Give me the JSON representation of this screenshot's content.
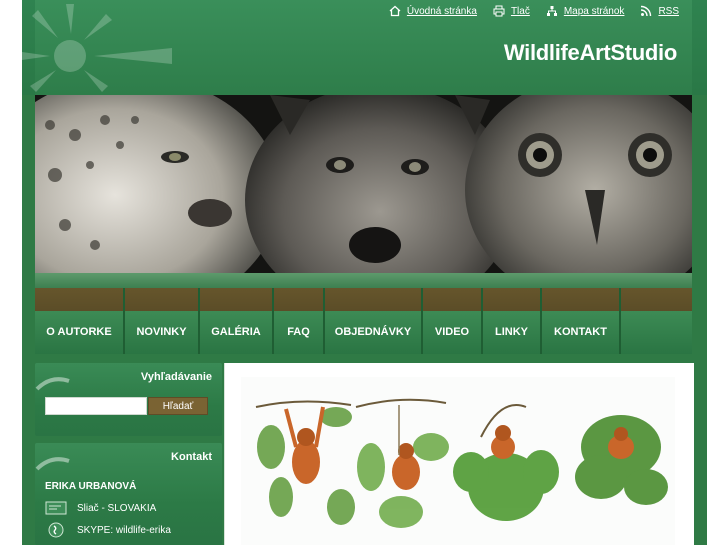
{
  "toplinks": [
    {
      "label": "Úvodná stránka",
      "icon": "home-icon"
    },
    {
      "label": "Tlač",
      "icon": "print-icon"
    },
    {
      "label": "Mapa stránok",
      "icon": "sitemap-icon"
    },
    {
      "label": "RSS",
      "icon": "rss-icon"
    }
  ],
  "site_title": "WildlifeArtStudio",
  "nav": [
    {
      "label": "O AUTORKE"
    },
    {
      "label": "NOVINKY"
    },
    {
      "label": "GALÉRIA"
    },
    {
      "label": "FAQ"
    },
    {
      "label": "OBJEDNÁVKY"
    },
    {
      "label": "VIDEO"
    },
    {
      "label": "LINKY"
    },
    {
      "label": "KONTAKT"
    }
  ],
  "search": {
    "title": "Vyhľadávanie",
    "value": "",
    "button_label": "Hľadať"
  },
  "contact": {
    "title": "Kontakt",
    "name": "ERIKA URBANOVÁ",
    "rows": [
      {
        "text": "Sliač - SLOVAKIA",
        "icon": "envelope-icon"
      },
      {
        "text": "SKYPE: wildlife-erika",
        "icon": "skype-icon"
      }
    ]
  },
  "colors": {
    "green": "#2f7a45",
    "brown": "#6b5a2e",
    "white": "#ffffff"
  }
}
